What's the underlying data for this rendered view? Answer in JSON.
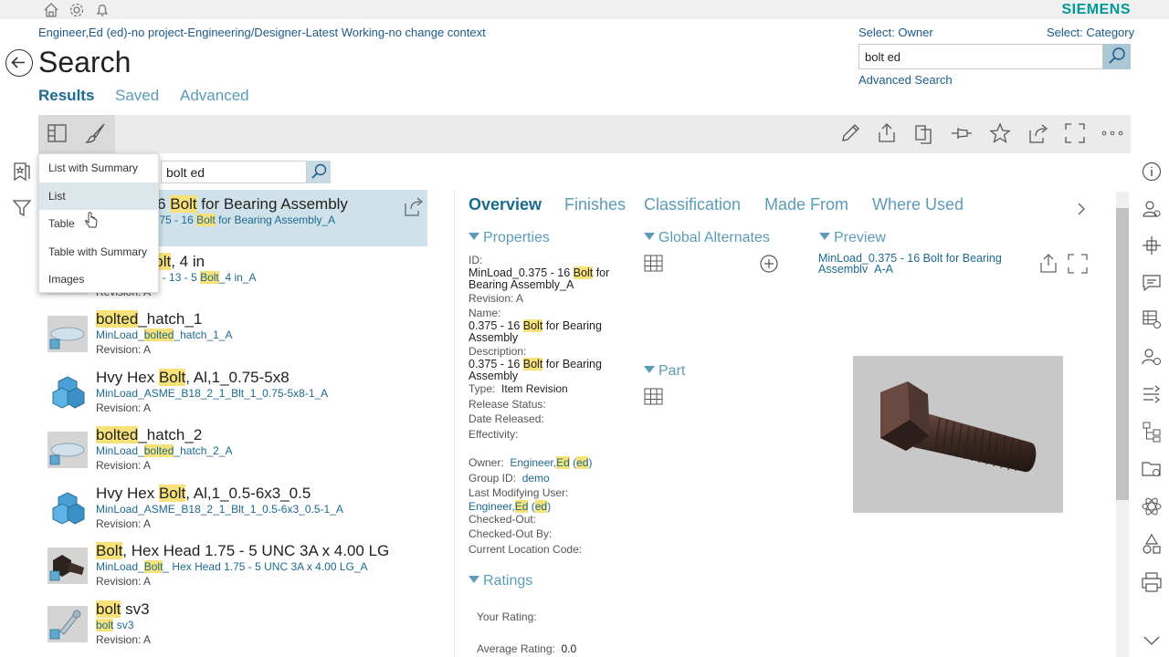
{
  "brand": "SIEMENS",
  "context": "Engineer,Ed (ed)-no project-Engineering/Designer-Latest Working-no change context",
  "page_title": "Search",
  "subtabs": [
    "Results",
    "Saved",
    "Advanced"
  ],
  "select_owner": "Select: Owner",
  "select_category": "Select: Category",
  "search_value": "bolt ed",
  "advanced_search": "Advanced Search",
  "filter_value": "bolt ed",
  "view_menu": [
    "List with Summary",
    "List",
    "Table",
    "Table with Summary",
    "Images"
  ],
  "results": [
    {
      "title_pre": "0.375 - 16 ",
      "title_hl": "Bolt",
      "title_post": " for Bearing Assembly",
      "sub_pre": "MinLoad_0.375 - 16 ",
      "sub_hl": "Bolt",
      "sub_post": " for Bearing Assembly_A",
      "rev": "Revision:  A",
      "thumb": "bolt-thumb"
    },
    {
      "title_pre": "1/2-13 ",
      "title_hl": "Bolt",
      "title_post": ", 4 in",
      "sub_pre": "MinLoad_0.5 - 13 - 5 ",
      "sub_hl": "Bolt",
      "sub_post": "_4 in_A",
      "rev": "Revision:  A",
      "thumb": "bolt-thumb"
    },
    {
      "title_pre": "",
      "title_hl": "bolted",
      "title_post": "_hatch_1",
      "sub_pre": "MinLoad_",
      "sub_hl": "bolted",
      "sub_post": "_hatch_1_A",
      "rev": "Revision:  A",
      "thumb": "hatch-thumb"
    },
    {
      "title_pre": "Hvy Hex ",
      "title_hl": "Bolt",
      "title_post": ", Al,1_0.75-5x8",
      "sub_pre": "MinLoad_ASME_B18_2_1_Blt_1_0.75-5x8-1_A",
      "sub_hl": "",
      "sub_post": "",
      "rev": "Revision:  A",
      "thumb": "part-thumb"
    },
    {
      "title_pre": "",
      "title_hl": "bolted",
      "title_post": "_hatch_2",
      "sub_pre": "MinLoad_",
      "sub_hl": "bolted",
      "sub_post": "_hatch_2_A",
      "rev": "Revision:  A",
      "thumb": "hatch-thumb"
    },
    {
      "title_pre": "Hvy Hex ",
      "title_hl": "Bolt",
      "title_post": ", Al,1_0.5-6x3_0.5",
      "sub_pre": "MinLoad_ASME_B18_2_1_Blt_1_0.5-6x3_0.5-1_A",
      "sub_hl": "",
      "sub_post": "",
      "rev": "Revision:  A",
      "thumb": "part-thumb"
    },
    {
      "title_pre": "",
      "title_hl": "Bolt",
      "title_post": ", Hex Head 1.75 - 5 UNC 3A x 4.00 LG",
      "sub_pre": "MinLoad_",
      "sub_hl": "Bolt",
      "sub_post": "_ Hex Head 1.75 - 5 UNC 3A x 4.00 LG_A",
      "rev": "Revision:  A",
      "thumb": "hexbolt-thumb"
    },
    {
      "title_pre": "",
      "title_hl": "bolt",
      "title_post": " sv3",
      "sub_pre": "",
      "sub_hl": "bolt",
      "sub_post": " sv3",
      "rev": "Revision:  A",
      "thumb": "sv3-thumb"
    }
  ],
  "detail_tabs": [
    "Overview",
    "Finishes",
    "Classification",
    "Made From",
    "Where Used"
  ],
  "sections": {
    "properties": "Properties",
    "global_alternates": "Global Alternates",
    "preview": "Preview",
    "part": "Part",
    "ratings": "Ratings"
  },
  "props": {
    "id_label": "ID:",
    "id_val_pre": "MinLoad_0.375 - 16 ",
    "id_val_hl": "Bolt",
    "id_val_post": " for Bearing Assembly_A",
    "revision": "Revision:  A",
    "name_label": "Name:",
    "name_pre": "0.375 - 16 ",
    "name_hl": "Bolt",
    "name_post": " for Bearing Assembly",
    "desc_label": "Description:",
    "desc_pre": "0.375 - 16 ",
    "desc_hl": "Bolt",
    "desc_post": " for Bearing Assembly",
    "type_label": "Type:",
    "type_val": "Item Revision",
    "release_status": "Release Status:",
    "date_released": "Date Released:",
    "effectivity": "Effectivity:",
    "owner_label": "Owner:",
    "owner_pre": "Engineer,",
    "owner_hl": "Ed",
    "owner_mid": " (",
    "owner_hl2": "ed",
    "owner_post": ")",
    "group_label": "Group ID:",
    "group_val": "demo",
    "lmu_label": "Last Modifying User:",
    "checked_out": "Checked-Out:",
    "checked_out_by": "Checked-Out By:",
    "location": "Current Location Code:"
  },
  "preview_link": "MinLoad_0.375 - 16 Bolt for Bearing Assembly_A-A",
  "ratings": {
    "your_rating": "Your Rating:",
    "avg_label": "Average Rating:",
    "avg_val": "0.0"
  },
  "colors": {
    "accent": "#1c6a8f",
    "brand": "#009999",
    "highlight": "#f7e27a",
    "selected_row": "#cfe1ea"
  }
}
